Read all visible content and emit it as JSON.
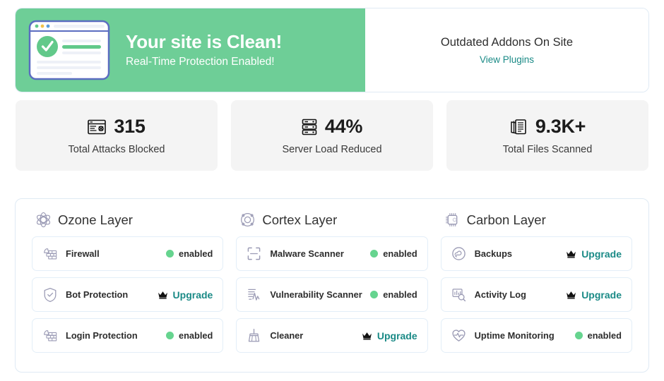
{
  "theme": {
    "green": "#6ece97",
    "teal": "#1a8a86",
    "dot_green": "#66d48f",
    "card_bg": "#f4f4f4",
    "border": "#dfeaf4",
    "illustration_frame": "#5b6dc0"
  },
  "banner": {
    "title": "Your site is Clean!",
    "subtitle": "Real-Time Protection Enabled!",
    "illustration_icon": "clean-site-browser-illustration",
    "addons_title": "Outdated Addons On Site",
    "addons_link": "View Plugins"
  },
  "stats": [
    {
      "value": "315",
      "label": "Total Attacks Blocked",
      "icon": "attack-blocked-icon"
    },
    {
      "value": "44%",
      "label": "Server Load Reduced",
      "icon": "server-rack-icon"
    },
    {
      "value": "9.3K+",
      "label": "Total Files Scanned",
      "icon": "files-stack-icon"
    }
  ],
  "layers": [
    {
      "title": "Ozone Layer",
      "icon": "atom-icon",
      "features": [
        {
          "name": "Firewall",
          "icon": "firewall-icon",
          "status": "enabled",
          "status_type": "enabled"
        },
        {
          "name": "Bot Protection",
          "icon": "shield-check-icon",
          "status": "Upgrade",
          "status_type": "upgrade"
        },
        {
          "name": "Login Protection",
          "icon": "firewall-icon",
          "status": "enabled",
          "status_type": "enabled"
        }
      ]
    },
    {
      "title": "Cortex Layer",
      "icon": "cortex-circle-icon",
      "features": [
        {
          "name": "Malware Scanner",
          "icon": "scan-frame-icon",
          "status": "enabled",
          "status_type": "enabled"
        },
        {
          "name": "Vulnerability Scanner",
          "icon": "radar-pulse-icon",
          "status": "enabled",
          "status_type": "enabled"
        },
        {
          "name": "Cleaner",
          "icon": "broom-icon",
          "status": "Upgrade",
          "status_type": "upgrade"
        }
      ]
    },
    {
      "title": "Carbon Layer",
      "icon": "cpu-chip-icon",
      "features": [
        {
          "name": "Backups",
          "icon": "cloud-sync-icon",
          "status": "Upgrade",
          "status_type": "upgrade"
        },
        {
          "name": "Activity Log",
          "icon": "log-search-icon",
          "status": "Upgrade",
          "status_type": "upgrade"
        },
        {
          "name": "Uptime Monitoring",
          "icon": "heart-pulse-icon",
          "status": "enabled",
          "status_type": "enabled"
        }
      ]
    }
  ]
}
